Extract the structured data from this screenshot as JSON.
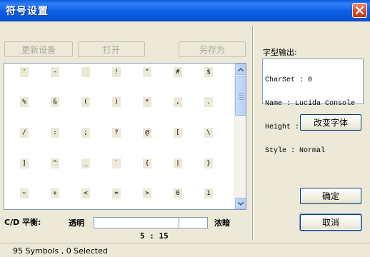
{
  "window": {
    "title": "符号设置"
  },
  "toolbar": {
    "refresh_label": "更新设备",
    "open_label": "打开",
    "save_as_label": "另存为"
  },
  "symbols": [
    [
      "'",
      "-",
      "",
      "!",
      "\"",
      "#",
      "$"
    ],
    [
      "%",
      "&",
      "(",
      ")",
      "*",
      ",",
      "."
    ],
    [
      "/",
      ":",
      ";",
      "?",
      "@",
      "[",
      "\\"
    ],
    [
      "]",
      "^",
      "_",
      "`",
      "{",
      "|",
      "}"
    ],
    [
      "~",
      "+",
      "<",
      "=",
      ">",
      "0",
      "1"
    ]
  ],
  "balance": {
    "label": "C/D 平衡:",
    "left_label": "透明",
    "right_label": "浓暗",
    "ratio_text": "5 : 15",
    "fraction": 0.75
  },
  "font_output": {
    "label": "字型输出:",
    "lines": [
      "CharSet : 0",
      "Name : Lucida Console",
      "Height : 11",
      "Style : Normal"
    ]
  },
  "buttons": {
    "change_font": "改变字体",
    "ok": "确定",
    "cancel": "取消"
  },
  "status": {
    "text": "95 Symbols , 0 Selected"
  },
  "colors": {
    "title_bar": "#0b5fe6",
    "window_bg": "#ece9d8",
    "close_button": "#d8452a"
  }
}
